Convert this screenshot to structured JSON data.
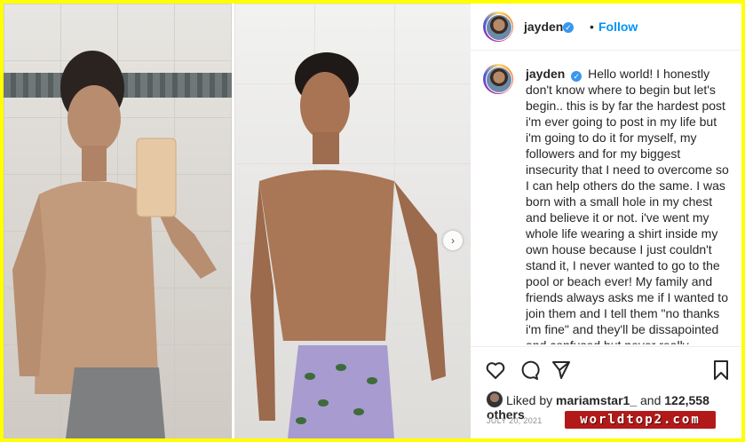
{
  "post": {
    "username": "jayden",
    "verified": true,
    "separator": "•",
    "follow_label": "Follow",
    "caption_text": "Hello world! I honestly don't know where to begin but let's begin.. this is by far the hardest post i'm ever going to post in my life but i'm going to do it for myself, my followers and for my biggest insecurity that I need to overcome so I can help others do the same. I was born with a small hole in my chest and believe it or not. i've went my whole life wearing a shirt inside my own house because I just couldn't stand it, I never wanted to go to the pool or beach ever! My family and friends always asks me if I wanted to join them and I tell them \"no thanks i'm fine\" and they'll be dissapointed and confused but never really understood the situations that I was going through. I was so skinny",
    "likes": {
      "prefix": "Liked by ",
      "user": "mariamstar1_",
      "middle": " and ",
      "count": "122,558 others"
    },
    "date": "JULY 20, 2021"
  },
  "media": {
    "left_photo": "before-photo",
    "right_photo": "after-photo",
    "next_icon": "chevron-right-icon"
  },
  "actions": {
    "icons": [
      "heart-icon",
      "comment-icon",
      "share-icon",
      "bookmark-icon"
    ]
  },
  "watermark": "worldtop2.com",
  "colors": {
    "border": "#ffff00",
    "accent": "#0095f6",
    "verified": "#3897f0",
    "watermark": "#b21a1a"
  }
}
